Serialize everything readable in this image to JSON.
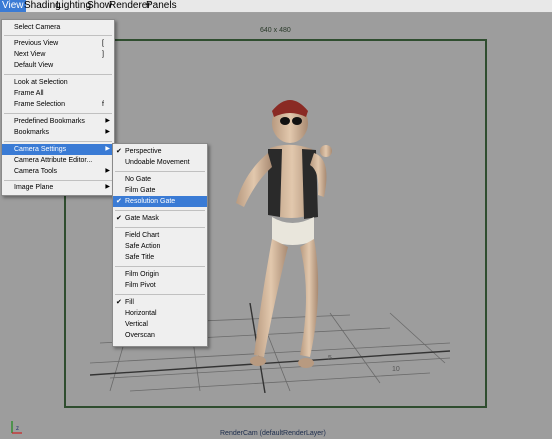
{
  "menubar": {
    "items": [
      "View",
      "Shading",
      "Lighting",
      "Show",
      "Renderer",
      "Panels"
    ]
  },
  "viewport": {
    "resolution": "640 x 480",
    "camera_label": "RenderCam (defaultRenderLayer)",
    "grid_numbers": [
      "5",
      "10"
    ]
  },
  "view_menu": {
    "select_camera": "Select Camera",
    "previous_view": "Previous View",
    "previous_shortcut": "[",
    "next_view": "Next View",
    "next_shortcut": "]",
    "default_view": "Default View",
    "look_at_selection": "Look at Selection",
    "frame_all": "Frame All",
    "frame_selection": "Frame Selection",
    "frame_selection_shortcut": "f",
    "predefined_bookmarks": "Predefined Bookmarks",
    "bookmarks": "Bookmarks",
    "camera_settings": "Camera Settings",
    "camera_attribute_editor": "Camera Attribute Editor...",
    "camera_tools": "Camera Tools",
    "image_plane": "Image Plane"
  },
  "camera_settings_menu": {
    "perspective": "Perspective",
    "undoable_movement": "Undoable Movement",
    "no_gate": "No Gate",
    "film_gate": "Film Gate",
    "resolution_gate": "Resolution Gate",
    "gate_mask": "Gate Mask",
    "field_chart": "Field Chart",
    "safe_action": "Safe Action",
    "safe_title": "Safe Title",
    "film_origin": "Film Origin",
    "film_pivot": "Film Pivot",
    "fill": "Fill",
    "horizontal": "Horizontal",
    "vertical": "Vertical",
    "overscan": "Overscan"
  },
  "icons": {
    "checkmark": "check-icon",
    "submenu": "submenu-arrow-icon"
  },
  "colors": {
    "highlight": "#3a7bd5",
    "gate_border": "#2f4d2f",
    "viewport_bg": "#9d9d9d"
  }
}
